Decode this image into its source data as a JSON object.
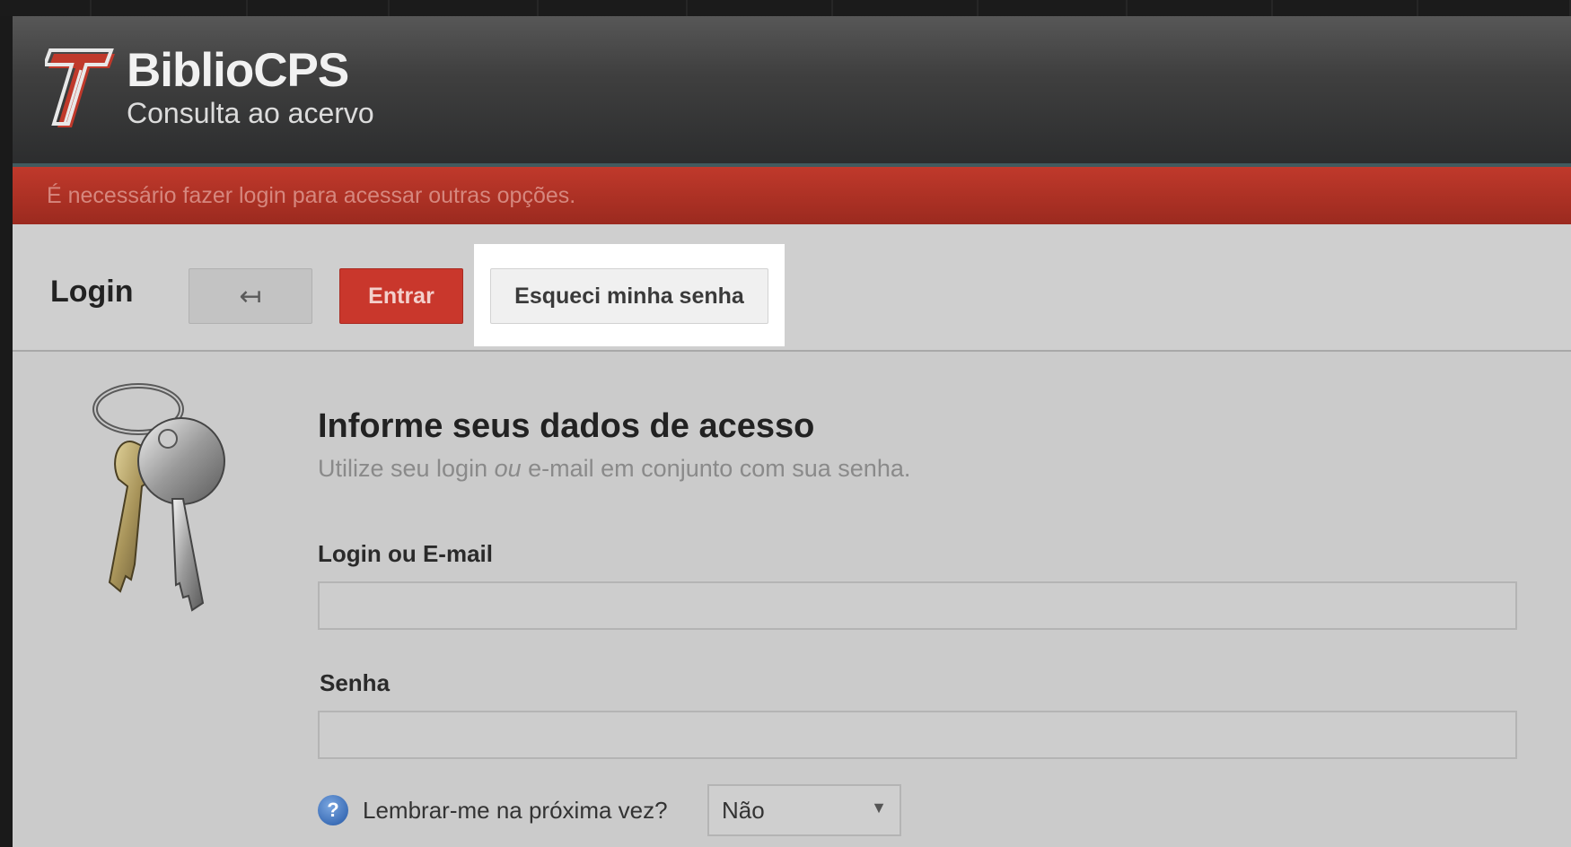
{
  "app": {
    "title": "BiblioCPS",
    "subtitle": "Consulta ao acervo"
  },
  "alert": {
    "message": "É necessário fazer login para acessar outras opções."
  },
  "toolbar": {
    "page_title": "Login",
    "back_icon": "↤",
    "enter_label": "Entrar",
    "forgot_label": "Esqueci minha senha"
  },
  "form": {
    "heading": "Informe seus dados de acesso",
    "subtitle_before": "Utilize seu login ",
    "subtitle_emph": "ou",
    "subtitle_after": " e-mail em conjunto com sua senha.",
    "login_label": "Login ou E-mail",
    "login_value": "",
    "password_label": "Senha",
    "password_value": "",
    "help_icon": "?",
    "remember_label": "Lembrar-me na próxima vez?",
    "remember_value": "Não",
    "select_arrow": "▼"
  },
  "colors": {
    "alert_red": "#b03326",
    "enter_button_red": "#c9372c",
    "header_dark": "#2c2d2e",
    "content_gray": "#cbcbcb"
  },
  "icons": {
    "logo": "bibliocps-logo-icon",
    "keys": "keys-icon",
    "help": "help-icon",
    "back": "back-arrow-icon"
  }
}
